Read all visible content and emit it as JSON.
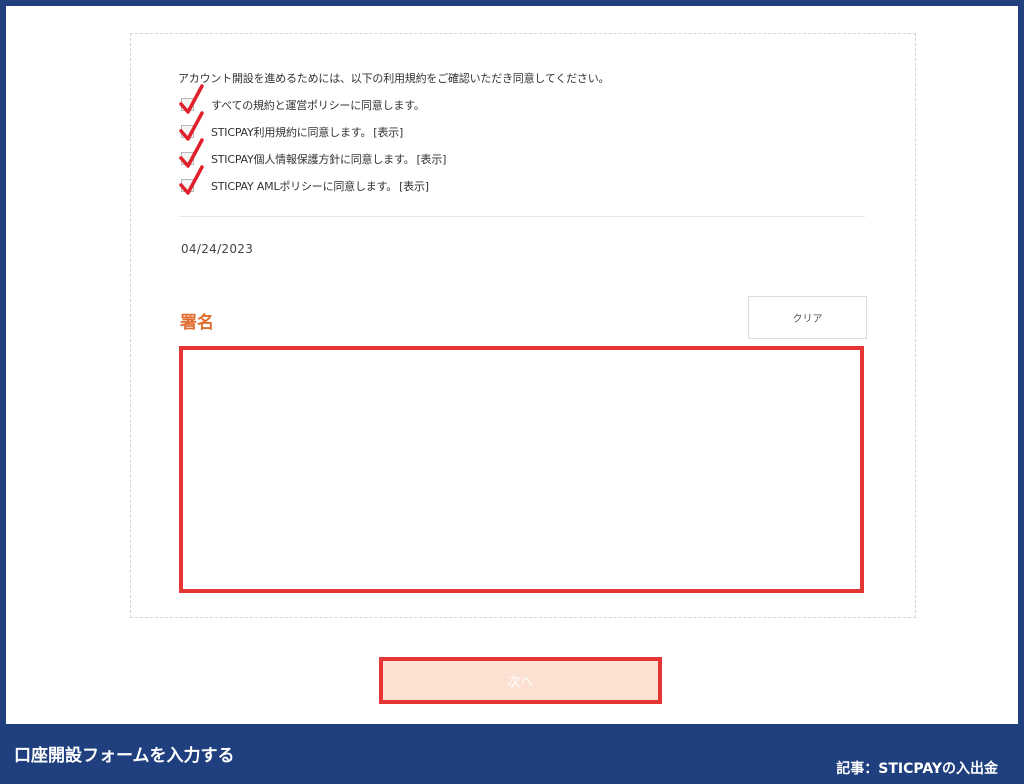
{
  "form": {
    "intro": "アカウント開設を進めるためには、以下の利用規約をご確認いただき同意してください。",
    "agreements": [
      {
        "label": "すべての規約と運営ポリシーに同意します。",
        "link": "",
        "checked": true
      },
      {
        "label": "STICPAY利用規約に同意します。",
        "link": "[表示]",
        "checked": true
      },
      {
        "label": "STICPAY個人情報保護方針に同意します。",
        "link": "[表示]",
        "checked": true
      },
      {
        "label": "STICPAY AMLポリシーに同意します。",
        "link": "[表示]",
        "checked": true
      }
    ],
    "date": "04/24/2023",
    "signature_title": "署名",
    "clear_label": "クリア",
    "next_label": "次へ"
  },
  "footer": {
    "caption": "口座開設フォームを入力する",
    "credit": "記事：STICPAYの入出金"
  },
  "colors": {
    "frame": "#1f3f7e",
    "highlight": "#e53535",
    "accent": "#e06d2f",
    "next_bg": "#fce0d2",
    "check": "#e0202a"
  }
}
